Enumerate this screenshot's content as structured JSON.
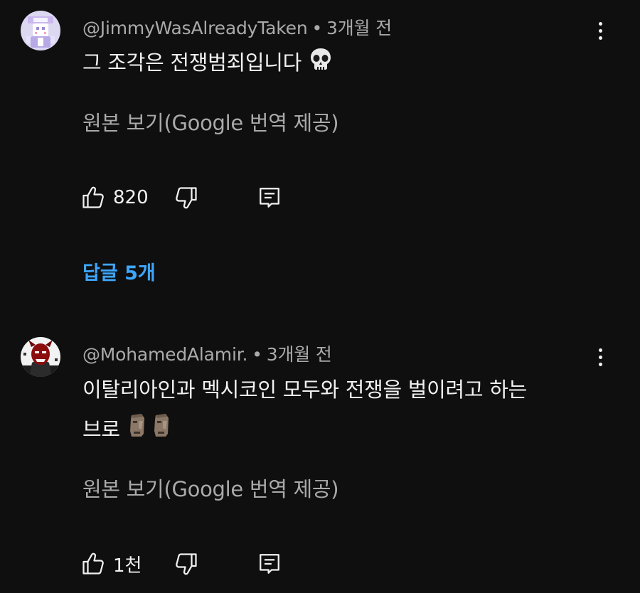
{
  "comments": [
    {
      "author": "@JimmyWasAlreadyTaken",
      "time": "3개월 전",
      "text": "그 조각은 전쟁범죄입니다",
      "emoji": "skull-icon",
      "translate_label": "원본 보기(Google 번역 제공)",
      "likes": "820",
      "replies_label": "답글 5개"
    },
    {
      "author": "@MohamedAlamir.",
      "time": "3개월 전",
      "text_line1": "이탈리아인과 멕시코인 모두와 전쟁을 벌이려고 하는",
      "text_line2": "브로",
      "emoji": "moai-icon",
      "translate_label": "원본 보기(Google 번역 제공)",
      "likes": "1천"
    }
  ],
  "colors": {
    "background": "#0f0f0f",
    "text": "#f1f1f1",
    "secondary": "#aaaaaa",
    "link": "#3ea6ff"
  }
}
